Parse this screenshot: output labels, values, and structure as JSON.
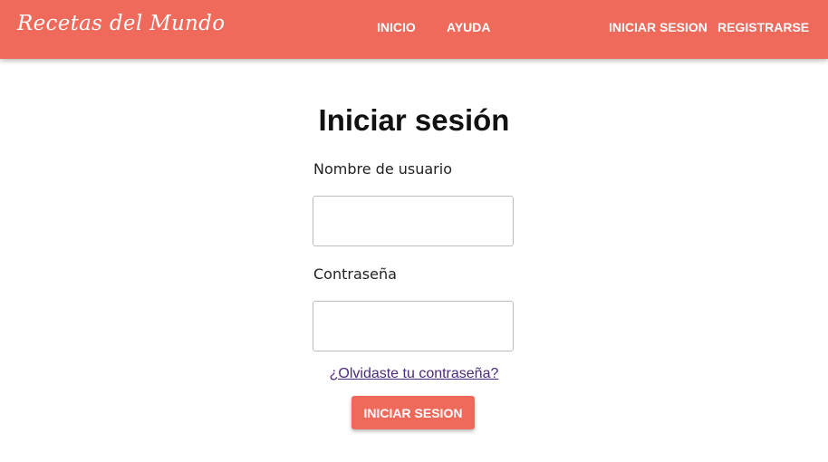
{
  "navbar": {
    "brand": "Recetas del Mundo",
    "links": {
      "inicio": "INICIO",
      "ayuda": "AYUDA",
      "login": "INICIAR SESION",
      "register": "REGISTRARSE"
    },
    "color": "#ef6a5a"
  },
  "form": {
    "title": "Iniciar sesión",
    "username_label": "Nombre de usuario",
    "username_value": "",
    "password_label": "Contraseña",
    "password_value": "",
    "forgot_link": "¿Olvidaste tu contraseña?",
    "submit_label": "INICIAR SESION",
    "submit_color": "#ef6a5a"
  }
}
